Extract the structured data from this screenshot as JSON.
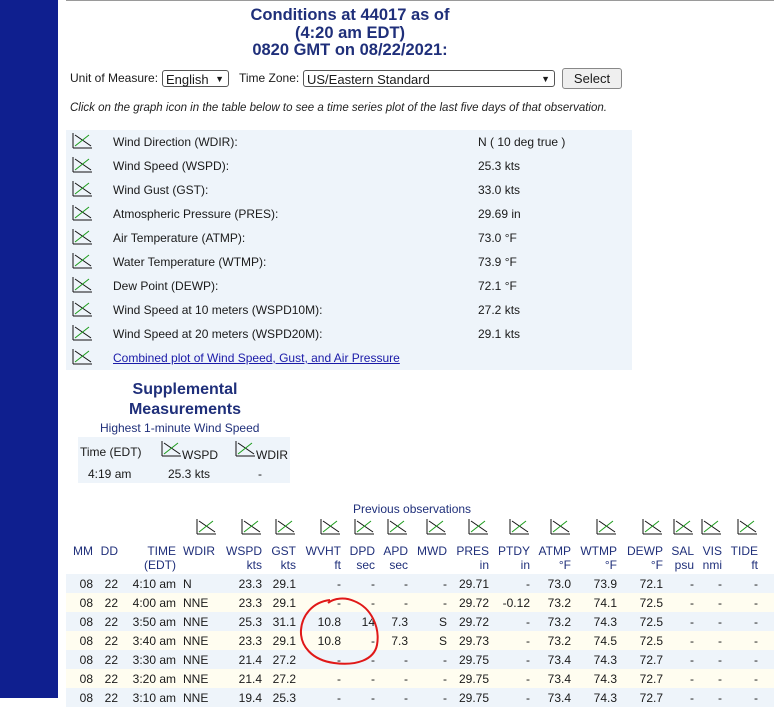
{
  "header": {
    "title_line1": "Conditions at 44017 as of",
    "title_line2": "(4:20 am EDT)",
    "title_line3": "0820 GMT on 08/22/2021:"
  },
  "controls": {
    "unit_label": "Unit of Measure:",
    "unit_value": "English",
    "tz_label": "Time Zone:",
    "tz_value": "US/Eastern Standard",
    "select_button": "Select"
  },
  "instruction": "Click on the graph icon in the table below to see a time series plot of the last five days of that observation.",
  "observations": [
    {
      "label": "Wind Direction (WDIR):",
      "value": "N ( 10 deg true )"
    },
    {
      "label": "Wind Speed (WSPD):",
      "value": "25.3 kts"
    },
    {
      "label": "Wind Gust (GST):",
      "value": "33.0 kts"
    },
    {
      "label": "Atmospheric Pressure (PRES):",
      "value": "29.69 in"
    },
    {
      "label": "Air Temperature (ATMP):",
      "value": "73.0 °F"
    },
    {
      "label": "Water Temperature (WTMP):",
      "value": "73.9 °F"
    },
    {
      "label": "Dew Point (DEWP):",
      "value": "72.1 °F"
    },
    {
      "label": "Wind Speed at 10 meters (WSPD10M):",
      "value": "27.2 kts"
    },
    {
      "label": "Wind Speed at 20 meters (WSPD20M):",
      "value": "29.1 kts"
    }
  ],
  "combined_link": "Combined plot of Wind Speed, Gust, and Air Pressure",
  "supplemental": {
    "title_line1": "Supplemental",
    "title_line2": "Measurements",
    "subtitle": "Highest 1-minute Wind Speed",
    "time_header": "Time (EDT)",
    "wspd_header": "WSPD",
    "wdir_header": "WDIR",
    "time": "4:19 am",
    "wspd": "25.3 kts",
    "wdir": "-"
  },
  "previous": {
    "caption": "Previous observations",
    "headers": {
      "mm": "MM",
      "dd": "DD",
      "time1": "TIME",
      "time2": "(EDT)",
      "wdir": "WDIR",
      "wspd1": "WSPD",
      "wspd2": "kts",
      "gst1": "GST",
      "gst2": "kts",
      "wvht1": "WVHT",
      "wvht2": "ft",
      "dpd1": "DPD",
      "dpd2": "sec",
      "apd1": "APD",
      "apd2": "sec",
      "mwd": "MWD",
      "pres1": "PRES",
      "pres2": "in",
      "ptdy1": "PTDY",
      "ptdy2": "in",
      "atmp1": "ATMP",
      "atmp2": "°F",
      "wtmp1": "WTMP",
      "wtmp2": "°F",
      "dewp1": "DEWP",
      "dewp2": "°F",
      "sal1": "SAL",
      "sal2": "psu",
      "vis1": "VIS",
      "vis2": "nmi",
      "tide1": "TIDE",
      "tide2": "ft"
    },
    "rows": [
      {
        "mm": "08",
        "dd": "22",
        "time": "4:10 am",
        "wdir": "N",
        "wspd": "23.3",
        "gst": "29.1",
        "wvht": "-",
        "dpd": "-",
        "apd": "-",
        "mwd": "-",
        "pres": "29.71",
        "ptdy": "-",
        "atmp": "73.0",
        "wtmp": "73.9",
        "dewp": "72.1",
        "sal": "-",
        "vis": "-",
        "tide": "-"
      },
      {
        "mm": "08",
        "dd": "22",
        "time": "4:00 am",
        "wdir": "NNE",
        "wspd": "23.3",
        "gst": "29.1",
        "wvht": "-",
        "dpd": "-",
        "apd": "-",
        "mwd": "-",
        "pres": "29.72",
        "ptdy": "-0.12",
        "atmp": "73.2",
        "wtmp": "74.1",
        "dewp": "72.5",
        "sal": "-",
        "vis": "-",
        "tide": "-"
      },
      {
        "mm": "08",
        "dd": "22",
        "time": "3:50 am",
        "wdir": "NNE",
        "wspd": "25.3",
        "gst": "31.1",
        "wvht": "10.8",
        "dpd": "14",
        "apd": "7.3",
        "mwd": "S",
        "pres": "29.72",
        "ptdy": "-",
        "atmp": "73.2",
        "wtmp": "74.3",
        "dewp": "72.5",
        "sal": "-",
        "vis": "-",
        "tide": "-"
      },
      {
        "mm": "08",
        "dd": "22",
        "time": "3:40 am",
        "wdir": "NNE",
        "wspd": "23.3",
        "gst": "29.1",
        "wvht": "10.8",
        "dpd": "-",
        "apd": "7.3",
        "mwd": "S",
        "pres": "29.73",
        "ptdy": "-",
        "atmp": "73.2",
        "wtmp": "74.5",
        "dewp": "72.5",
        "sal": "-",
        "vis": "-",
        "tide": "-"
      },
      {
        "mm": "08",
        "dd": "22",
        "time": "3:30 am",
        "wdir": "NNE",
        "wspd": "21.4",
        "gst": "27.2",
        "wvht": "-",
        "dpd": "-",
        "apd": "-",
        "mwd": "-",
        "pres": "29.75",
        "ptdy": "-",
        "atmp": "73.4",
        "wtmp": "74.3",
        "dewp": "72.7",
        "sal": "-",
        "vis": "-",
        "tide": "-"
      },
      {
        "mm": "08",
        "dd": "22",
        "time": "3:20 am",
        "wdir": "NNE",
        "wspd": "21.4",
        "gst": "27.2",
        "wvht": "-",
        "dpd": "-",
        "apd": "-",
        "mwd": "-",
        "pres": "29.75",
        "ptdy": "-",
        "atmp": "73.4",
        "wtmp": "74.3",
        "dewp": "72.7",
        "sal": "-",
        "vis": "-",
        "tide": "-"
      },
      {
        "mm": "08",
        "dd": "22",
        "time": "3:10 am",
        "wdir": "NNE",
        "wspd": "19.4",
        "gst": "25.3",
        "wvht": "-",
        "dpd": "-",
        "apd": "-",
        "mwd": "-",
        "pres": "29.75",
        "ptdy": "-",
        "atmp": "73.4",
        "wtmp": "74.3",
        "dewp": "72.7",
        "sal": "-",
        "vis": "-",
        "tide": "-"
      }
    ]
  },
  "colors": {
    "accent": "#1f2f7a",
    "left_bar": "#0f1f8f",
    "panel": "#eef4fa",
    "annotation": "#e01818"
  }
}
